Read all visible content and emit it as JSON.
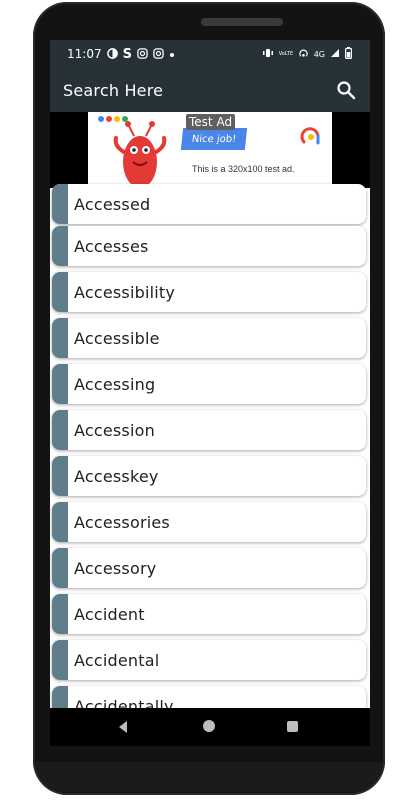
{
  "status_bar": {
    "time": "11:07",
    "network": "4G",
    "volte": "VoLTE",
    "icons": [
      "data-saver-icon",
      "s-app-icon",
      "instagram-icon",
      "instagram-icon",
      "dot-icon",
      "vibrate-icon",
      "volte-icon",
      "hotspot-icon",
      "signal-icon",
      "battery-icon"
    ]
  },
  "app_bar": {
    "title": "Search Here",
    "search_icon": "search-icon"
  },
  "ad": {
    "badge": "Test Ad",
    "banner": "Nice job!",
    "text": "This is a 320x100 test ad.",
    "dot_colors": [
      "#4285f4",
      "#ea4335",
      "#fbbc04",
      "#34a853"
    ]
  },
  "list": {
    "items": [
      "Accessed",
      "Accesses",
      "Accessibility",
      "Accessible",
      "Accessing",
      "Accession",
      "Accesskey",
      "Accessories",
      "Accessory",
      "Accident",
      "Accidental",
      "Accidentally"
    ]
  },
  "nav_bar": {
    "icons": [
      "back-icon",
      "home-icon",
      "recents-icon"
    ]
  },
  "colors": {
    "app_bar": "#263238",
    "accent": "#607d8b"
  }
}
